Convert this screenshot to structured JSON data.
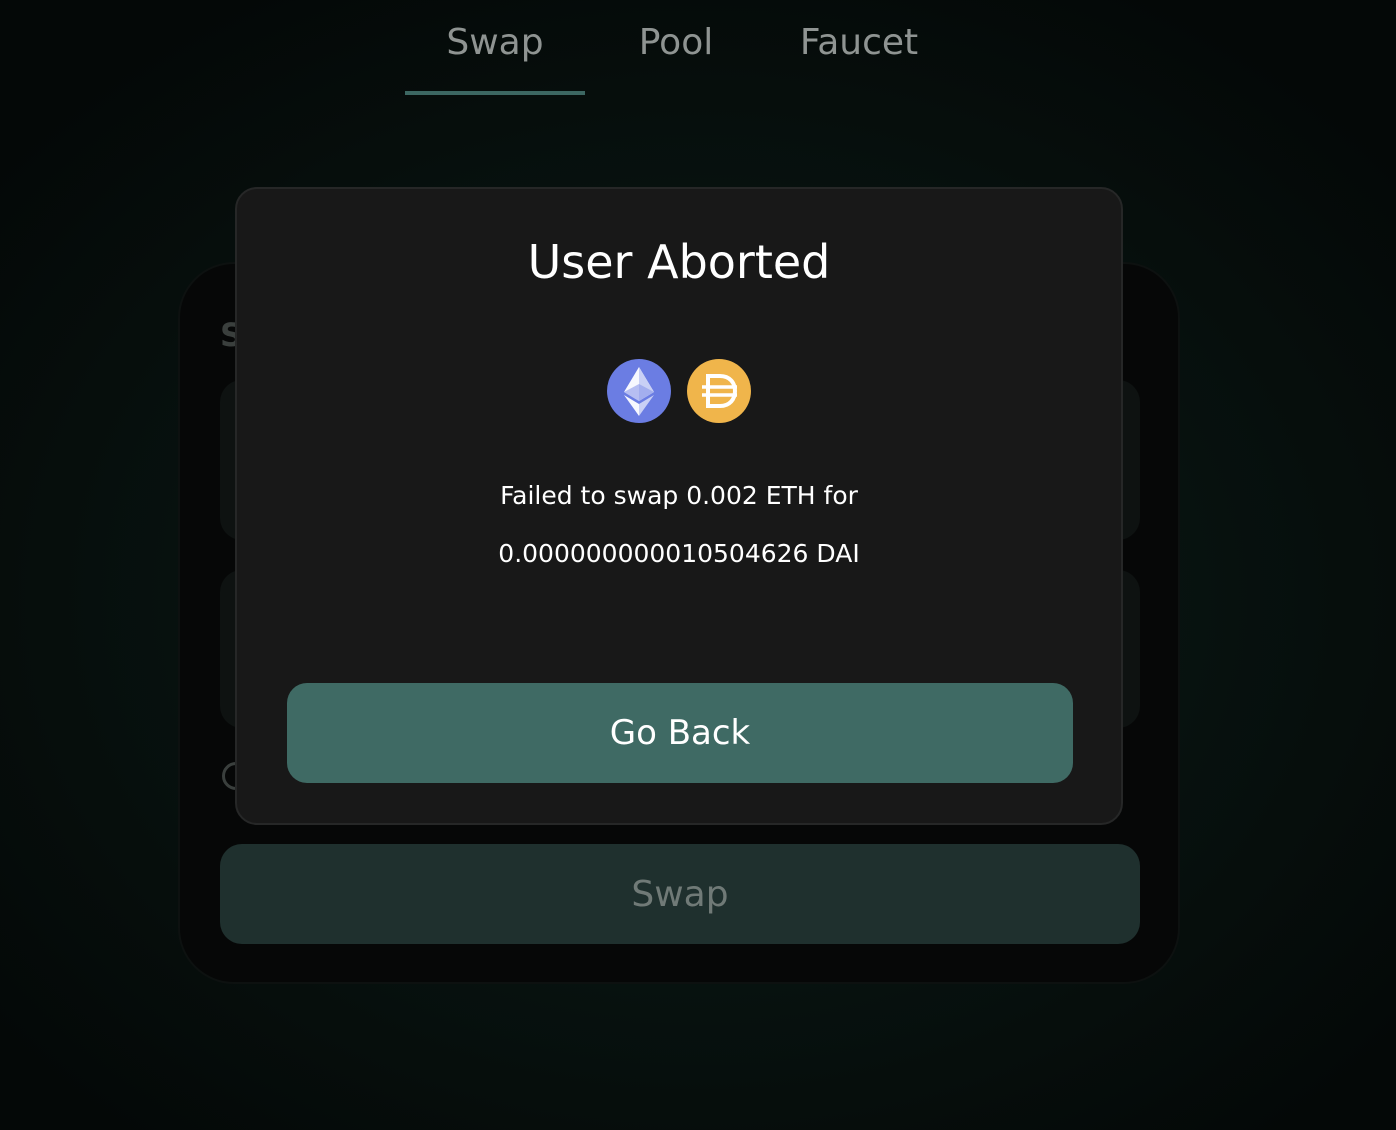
{
  "nav": {
    "tabs": [
      {
        "label": "Swap",
        "active": true
      },
      {
        "label": "Pool",
        "active": false
      },
      {
        "label": "Faucet",
        "active": false
      }
    ]
  },
  "swap_card": {
    "heading_visible": "S",
    "swap_button_label": "Swap"
  },
  "modal": {
    "title": "User Aborted",
    "tokens": [
      {
        "icon": "eth-icon",
        "color": "#6b7de3"
      },
      {
        "icon": "dai-icon",
        "color": "#f0b54b"
      }
    ],
    "message_line1": "Failed to swap 0.002 ETH for",
    "message_line2": "0.000000000010504626 DAI",
    "button_label": "Go Back"
  },
  "colors": {
    "accent": "#3f6a64",
    "modal_bg": "#181818",
    "tab_underline": "#3c6762"
  }
}
